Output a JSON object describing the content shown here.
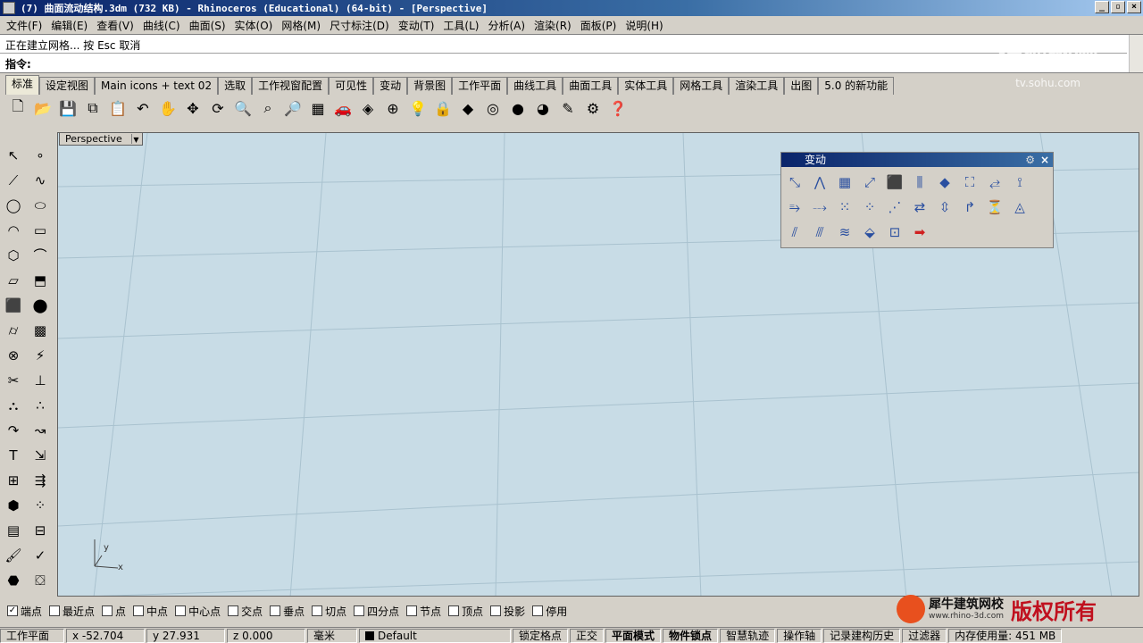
{
  "window": {
    "title": "(7) 曲面流动结构.3dm (732 KB) - Rhinoceros (Educational) (64-bit) - [Perspective]",
    "buttons": [
      "_",
      "▫",
      "×"
    ]
  },
  "menu": [
    "文件(F)",
    "编辑(E)",
    "查看(V)",
    "曲线(C)",
    "曲面(S)",
    "实体(O)",
    "网格(M)",
    "尺寸标注(D)",
    "变动(T)",
    "工具(L)",
    "分析(A)",
    "渲染(R)",
    "面板(P)",
    "说明(H)"
  ],
  "command": {
    "history": "正在建立网格... 按 Esc 取消",
    "prompt": "指令:"
  },
  "tabs": [
    "标准",
    "设定视图",
    "Main icons + text 02",
    "选取",
    "工作视窗配置",
    "可见性",
    "变动",
    "背景图",
    "工作平面",
    "曲线工具",
    "曲面工具",
    "实体工具",
    "网格工具",
    "渲染工具",
    "出图",
    "5.0 的新功能"
  ],
  "viewport": {
    "name": "Perspective",
    "axis_y": "y",
    "axis_x": "x"
  },
  "panel": {
    "title": "变动"
  },
  "osnap": [
    {
      "label": "端点",
      "checked": true
    },
    {
      "label": "最近点",
      "checked": false
    },
    {
      "label": "点",
      "checked": false
    },
    {
      "label": "中点",
      "checked": false
    },
    {
      "label": "中心点",
      "checked": false
    },
    {
      "label": "交点",
      "checked": false
    },
    {
      "label": "垂点",
      "checked": false
    },
    {
      "label": "切点",
      "checked": false
    },
    {
      "label": "四分点",
      "checked": false
    },
    {
      "label": "节点",
      "checked": false
    },
    {
      "label": "顶点",
      "checked": false
    },
    {
      "label": "投影",
      "checked": false
    },
    {
      "label": "停用",
      "checked": false
    }
  ],
  "status": {
    "cplane": "工作平面",
    "x": "x -52.704",
    "y": "y 27.931",
    "z": "z 0.000",
    "unit": "毫米",
    "layer": "Default",
    "grid_snap": "锁定格点",
    "ortho": "正交",
    "planar": "平面模式",
    "osnap": "物件锁点",
    "smarttrack": "智慧轨迹",
    "gumball": "操作轴",
    "history": "记录建构历史",
    "filter": "过滤器",
    "memory": "内存使用量: 451 MB"
  },
  "watermark": {
    "name": "犀牛建筑网校",
    "url": "www.rhino-3d.com",
    "rights": "版权所有",
    "sohu": "搜狐视频",
    "sohu_url": "tv.sohu.com"
  }
}
